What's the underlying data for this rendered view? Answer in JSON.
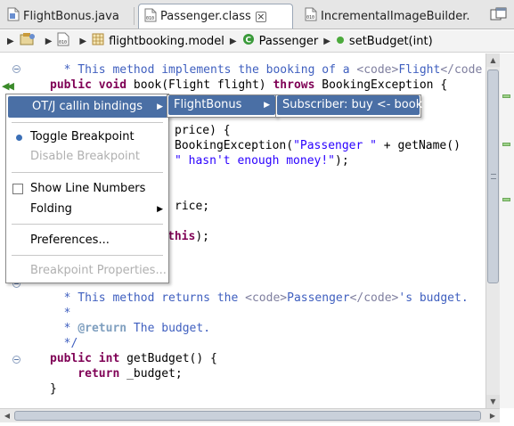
{
  "tabs": [
    {
      "label": "FlightBonus.java",
      "active": false
    },
    {
      "label": "Passenger.class",
      "active": true
    },
    {
      "label": "IncrementalImageBuilder.",
      "active": false
    }
  ],
  "breadcrumb": {
    "package": "flightbooking.model",
    "class": "Passenger",
    "method": "setBudget(int)"
  },
  "code_lines": {
    "l1a": "  * This method implements the booking of a ",
    "l1b": "<code>",
    "l1c": "Flight",
    "l1d": "</code",
    "l2a": "public void ",
    "l2b": "book(Flight flight) ",
    "l2c": "throws ",
    "l2d": "BookingException {",
    "l4": "price) {",
    "l5a": "BookingException(",
    "l5b": "\"Passenger \"",
    "l5c": " + getName()",
    "l6a": "\" hasn't enough money!\"",
    "l6b": ");",
    "l8": "rice;",
    "l10a": "this",
    "l10b": ");",
    "l14a": "  * This method returns the ",
    "l14b": "<code>",
    "l14c": "Passenger",
    "l14d": "</code>",
    "l14e": "'s budget.",
    "l15": "  *",
    "l16a": "  * ",
    "l16b": "@return",
    "l16c": " The budget.",
    "l17": "  */",
    "l18a": "public int ",
    "l18b": "getBudget() {",
    "l19a": "    return ",
    "l19b": "_budget;",
    "l20": "}"
  },
  "context_menu": {
    "callin": "OT/J callin bindings",
    "toggle_breakpoint": "Toggle Breakpoint",
    "disable_breakpoint": "Disable Breakpoint",
    "show_line_numbers": "Show Line Numbers",
    "folding": "Folding",
    "preferences": "Preferences...",
    "breakpoint_properties": "Breakpoint Properties..."
  },
  "submenu1": {
    "item": "FlightBonus"
  },
  "submenu2": {
    "item": "Subscriber: buy <- book"
  },
  "colors": {
    "keyword": "#7f0055",
    "comment": "#3f5fbf",
    "string": "#2a00ff",
    "menu_highlight": "#4a6fa5"
  }
}
